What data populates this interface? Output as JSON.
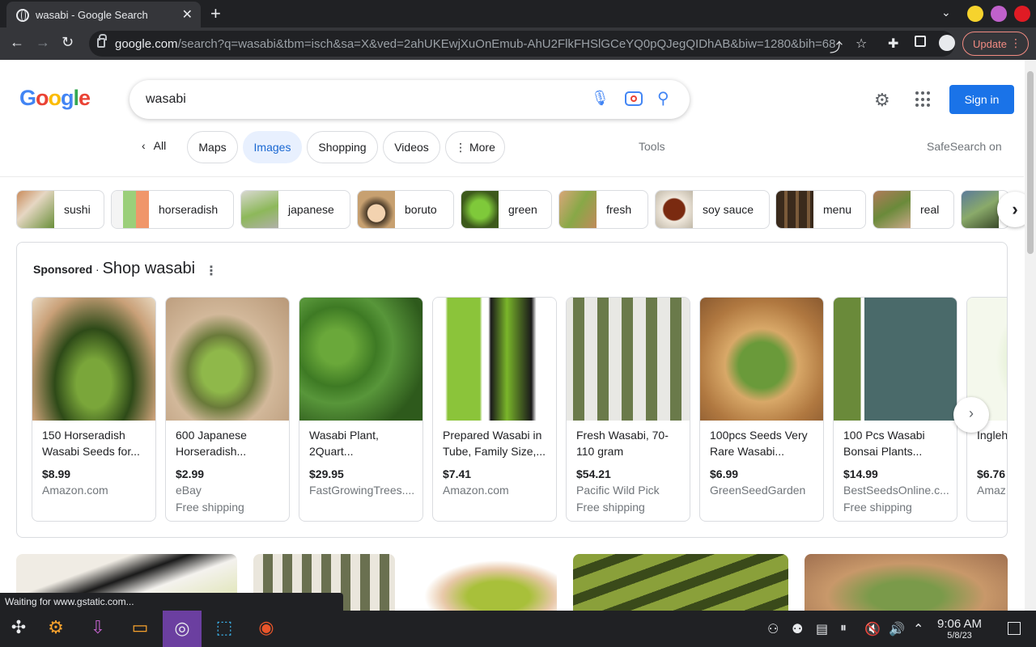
{
  "browser": {
    "tab_title": "wasabi - Google Search",
    "url_host": "google.com",
    "url_path": "/search?q=wasabi&tbm=isch&sa=X&ved=2ahUKEwjXuOnEmub-AhU2FlkFHSlGCeYQ0pQJegQIDhAB&biw=1280&bih=68...",
    "update_label": "Update",
    "status_text": "Waiting for www.gstatic.com..."
  },
  "google": {
    "query": "wasabi",
    "sign_in": "Sign in",
    "filters": {
      "back": "All",
      "maps": "Maps",
      "images": "Images",
      "shopping": "Shopping",
      "videos": "Videos",
      "more": "More",
      "tools": "Tools",
      "safesearch": "SafeSearch on"
    },
    "related": [
      "sushi",
      "horseradish",
      "japanese",
      "boruto",
      "green",
      "fresh",
      "soy sauce",
      "menu",
      "real"
    ],
    "shop": {
      "sponsored": "Sponsored",
      "separator": " · ",
      "title": "Shop wasabi",
      "cards": [
        {
          "name": "150 Horseradish Wasabi Seeds for...",
          "price": "$8.99",
          "store": "Amazon.com",
          "ship": ""
        },
        {
          "name": "600 Japanese Horseradish...",
          "price": "$2.99",
          "store": "eBay",
          "ship": "Free shipping"
        },
        {
          "name": "Wasabi Plant, 2Quart...",
          "price": "$29.95",
          "store": "FastGrowingTrees....",
          "ship": ""
        },
        {
          "name": "Prepared Wasabi in Tube, Family Size,...",
          "price": "$7.41",
          "store": "Amazon.com",
          "ship": ""
        },
        {
          "name": "Fresh Wasabi, 70-110 gram",
          "price": "$54.21",
          "store": "Pacific Wild Pick",
          "ship": "Free shipping"
        },
        {
          "name": "100pcs Seeds Very Rare Wasabi...",
          "price": "$6.99",
          "store": "GreenSeedGarden",
          "ship": ""
        },
        {
          "name": "100 Pcs Wasabi Bonsai Plants...",
          "price": "$14.99",
          "store": "BestSeedsOnline.c...",
          "ship": "Free shipping"
        },
        {
          "name": "Ingleh Horse",
          "price": "$6.76",
          "store": "Amaz",
          "ship": ""
        }
      ]
    }
  },
  "taskbar": {
    "time": "9:06 AM",
    "date": "5/8/23"
  },
  "colors": {
    "accent": "#1a73e8",
    "chrome_dark": "#202124",
    "chrome_mid": "#35363a",
    "update_red": "#f28b82"
  }
}
